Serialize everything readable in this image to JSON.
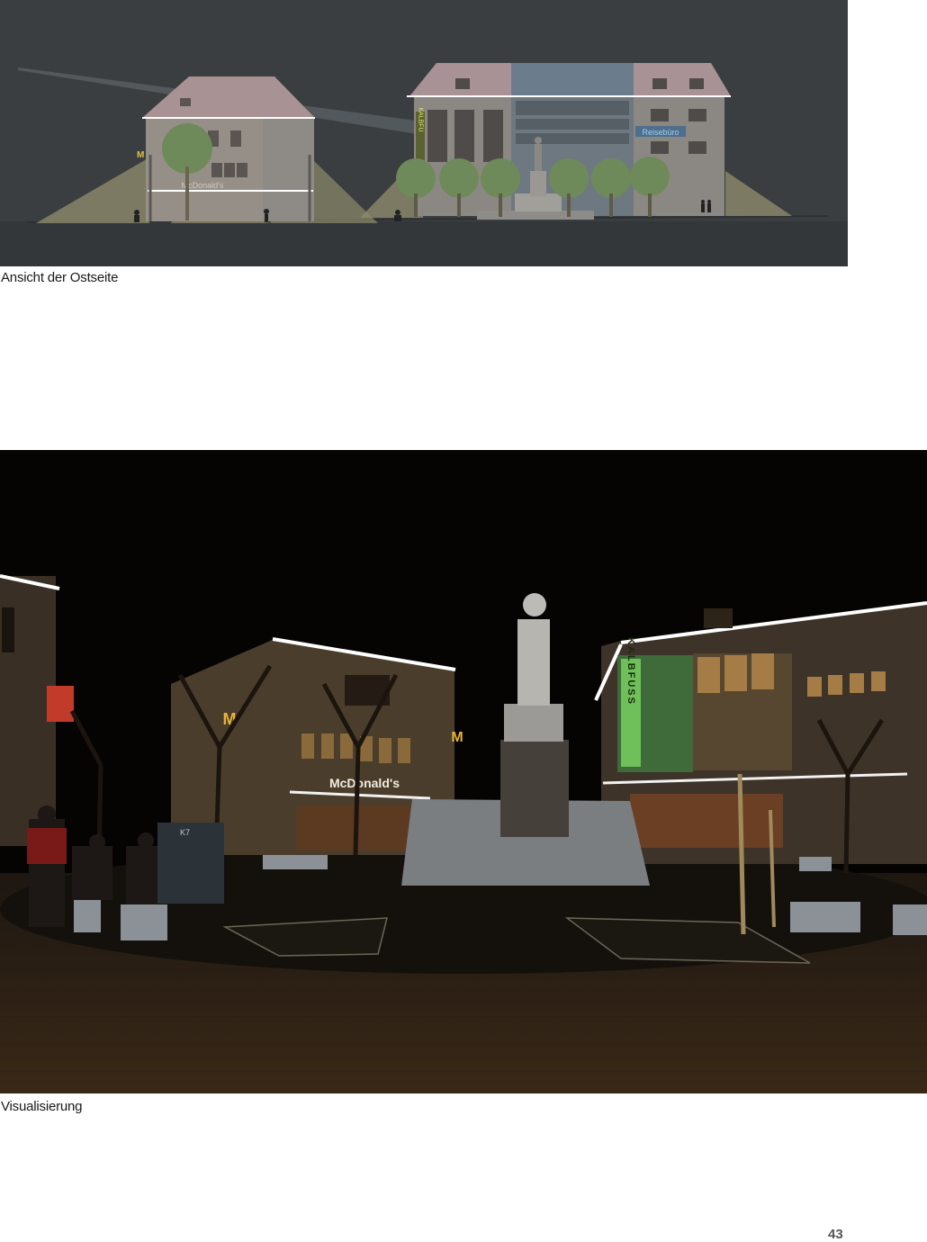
{
  "figures": [
    {
      "caption": "Ansicht der Ostseite",
      "signs": {
        "mcdonalds_name": "McDonald's",
        "mcdonalds_logo": "M",
        "kalbfuss_vertical": "KALBFU",
        "reiseburo": "Reisebüro"
      }
    },
    {
      "caption": "Visualisierung",
      "signs": {
        "mcdonalds_name": "McDonald's",
        "mcdonalds_logo": "M",
        "kalbfuss_vertical": "KALBFUSS",
        "kiosk_number": "K7"
      }
    }
  ],
  "page_number": "43",
  "colors": {
    "elevation_bg": "#3b3e40",
    "light_strip": "#ffffff",
    "light_cone": "#c8c08a",
    "night_sky": "#050403"
  }
}
